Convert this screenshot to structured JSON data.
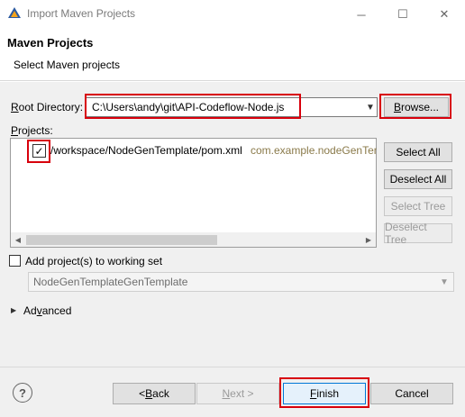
{
  "window": {
    "title": "Import Maven Projects",
    "controls": {
      "minimize": "─",
      "maximize": "☐",
      "close": "✕"
    }
  },
  "header": {
    "title": "Maven Projects",
    "subtitle": "Select Maven projects"
  },
  "root": {
    "label_prefix": "R",
    "label_rest": "oot Directory:",
    "value": "C:\\Users\\andy\\git\\API-Codeflow-Node.js",
    "browse_prefix": "B",
    "browse_rest": "rowse..."
  },
  "projects": {
    "label_prefix": "P",
    "label_rest": "rojects:",
    "items": [
      {
        "checked": true,
        "path": "/workspace/NodeGenTemplate/pom.xml",
        "artifact": "com.example.nodeGenTemplate"
      }
    ]
  },
  "side_buttons": {
    "select_all": "Select All",
    "deselect_all": "Deselect All",
    "select_tree": "Select Tree",
    "deselect_tree": "Deselect Tree"
  },
  "working_set": {
    "label": "Add project(s) to working set",
    "value": "NodeGenTemplateGenTemplate"
  },
  "advanced": {
    "label_prefix": "Ad",
    "label_u": "v",
    "label_rest": "anced"
  },
  "footer": {
    "help": "?",
    "back_lt": "< ",
    "back_u": "B",
    "back_rest": "ack",
    "next_u": "N",
    "next_rest": "ext >",
    "finish_u": "F",
    "finish_rest": "inish",
    "cancel": "Cancel"
  },
  "colors": {
    "highlight": "#d8000c",
    "artifact_text": "#8a7a4a",
    "dialog_bg": "#f0f0f0"
  }
}
